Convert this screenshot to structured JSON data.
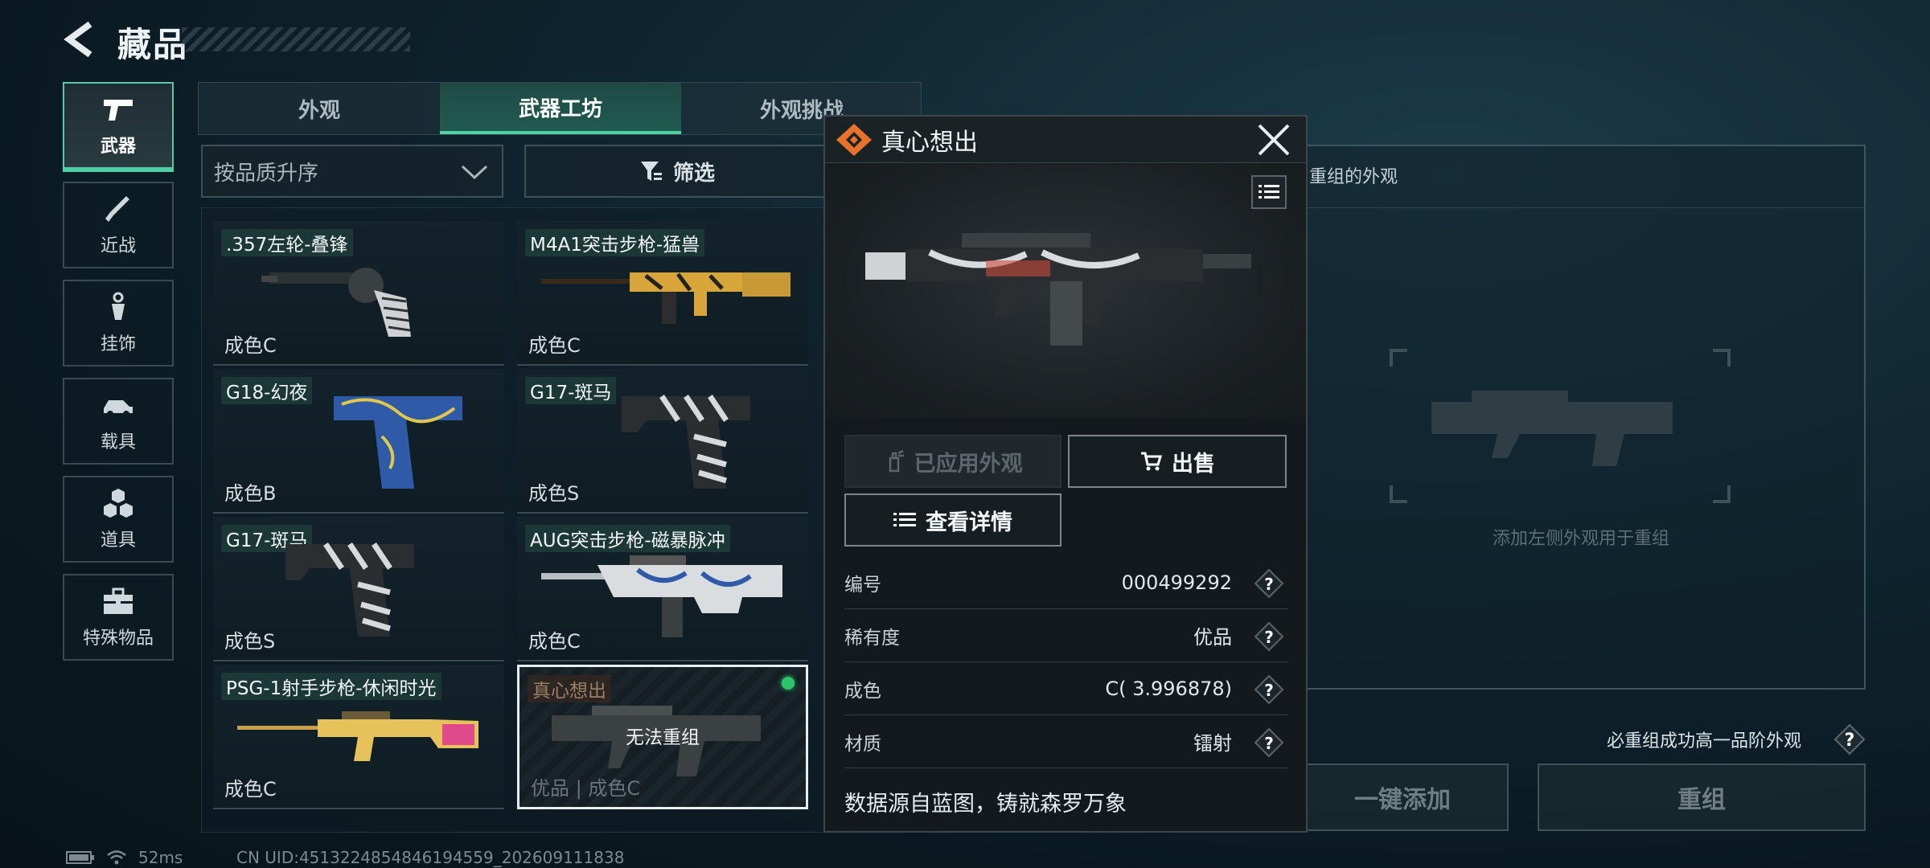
{
  "header": {
    "title": "藏品"
  },
  "sidebar": {
    "items": [
      {
        "label": "武器",
        "icon": "pistol-icon",
        "active": true
      },
      {
        "label": "近战",
        "icon": "knife-icon",
        "active": false
      },
      {
        "label": "挂饰",
        "icon": "charm-icon",
        "active": false
      },
      {
        "label": "载具",
        "icon": "vehicle-icon",
        "active": false
      },
      {
        "label": "道具",
        "icon": "items-icon",
        "active": false
      },
      {
        "label": "特殊物品",
        "icon": "toolbox-icon",
        "active": false
      }
    ]
  },
  "tabs": [
    {
      "label": "外观",
      "active": false
    },
    {
      "label": "武器工坊",
      "active": true
    },
    {
      "label": "外观挑战",
      "active": false
    }
  ],
  "controls": {
    "sort_label": "按品质升序",
    "filter_label": "筛选"
  },
  "grid": {
    "items": [
      {
        "name": ".357左轮-叠锋",
        "grade": "成色C"
      },
      {
        "name": "M4A1突击步枪-猛兽",
        "grade": "成色C"
      },
      {
        "name": "G18-幻夜",
        "grade": "成色B"
      },
      {
        "name": "G17-斑马",
        "grade": "成色S"
      },
      {
        "name": "G17-斑马",
        "grade": "成色S"
      },
      {
        "name": "AUG突击步枪-磁暴脉冲",
        "grade": "成色C"
      },
      {
        "name": "PSG-1射手步枪-休闲时光",
        "grade": "成色C"
      },
      {
        "name": "真心想出",
        "grade": "优品 | 成色C",
        "overlay": "无法重组",
        "selected": true
      }
    ]
  },
  "status": {
    "ping": "52ms",
    "uid": "CN UID:4513224854846194559_202609111838"
  },
  "right_panel": {
    "header": "重组的外观",
    "hint": "添加左侧外观用于重组",
    "must_text": "必重组成功高一品阶外观",
    "add_button": "一键添加",
    "regroup_button": "重组"
  },
  "popup": {
    "title": "真心想出",
    "applied_button": "已应用外观",
    "sell_button": "出售",
    "detail_button": "查看详情",
    "rows": [
      {
        "key": "编号",
        "value": "000499292"
      },
      {
        "key": "稀有度",
        "value": "优品"
      },
      {
        "key": "成色",
        "value": "C( 3.996878)"
      },
      {
        "key": "材质",
        "value": "镭射"
      }
    ],
    "description": "数据源自蓝图，铸就森罗万象"
  },
  "colors": {
    "accent": "#4fd0a4",
    "popup_logo": "#e8722a",
    "status_dot": "#2ec46b"
  }
}
